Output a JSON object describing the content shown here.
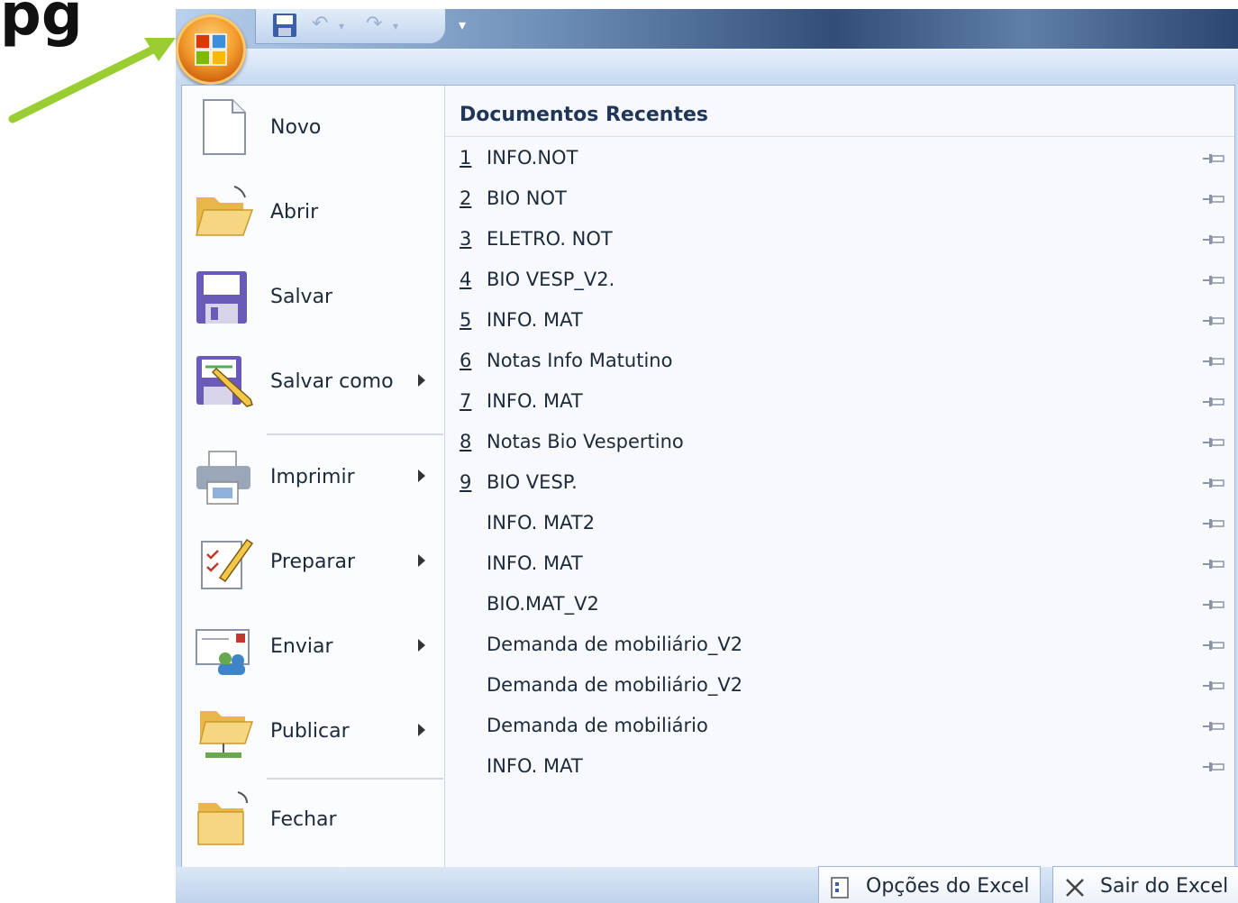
{
  "overlay": {
    "heading_fragment": "pg"
  },
  "quick_access": {
    "save_icon": "save-icon",
    "undo_icon": "undo-icon",
    "redo_icon": "redo-icon",
    "customize_icon": "customize-icon"
  },
  "office_button": {
    "icon": "office-logo-icon"
  },
  "commands": [
    {
      "label": "Novo",
      "icon": "new-document-icon"
    },
    {
      "label": "Abrir",
      "icon": "open-folder-icon"
    },
    {
      "label": "Salvar",
      "icon": "save-icon"
    },
    {
      "label": "Salvar como",
      "icon": "save-as-icon"
    },
    {
      "label": "Imprimir",
      "icon": "printer-icon"
    },
    {
      "label": "Preparar",
      "icon": "prepare-icon"
    },
    {
      "label": "Enviar",
      "icon": "send-icon"
    },
    {
      "label": "Publicar",
      "icon": "publish-icon"
    },
    {
      "label": "Fechar",
      "icon": "close-folder-icon"
    }
  ],
  "recent": {
    "title": "Documentos Recentes",
    "documents": [
      {
        "num": "1",
        "name": "INFO.NOT"
      },
      {
        "num": "2",
        "name": "BIO NOT"
      },
      {
        "num": "3",
        "name": "ELETRO. NOT"
      },
      {
        "num": "4",
        "name": "BIO VESP_V2."
      },
      {
        "num": "5",
        "name": "INFO. MAT"
      },
      {
        "num": "6",
        "name": "Notas Info Matutino"
      },
      {
        "num": "7",
        "name": "INFO. MAT"
      },
      {
        "num": "8",
        "name": "Notas Bio Vespertino"
      },
      {
        "num": "9",
        "name": "BIO VESP."
      },
      {
        "num": "",
        "name": "INFO. MAT2"
      },
      {
        "num": "",
        "name": "INFO. MAT"
      },
      {
        "num": "",
        "name": "BIO.MAT_V2"
      },
      {
        "num": "",
        "name": "Demanda de mobiliário_V2"
      },
      {
        "num": "",
        "name": "Demanda de mobiliário_V2"
      },
      {
        "num": "",
        "name": "Demanda de mobiliário"
      },
      {
        "num": "",
        "name": "INFO. MAT"
      }
    ]
  },
  "footer": {
    "options_label": "Opções do Excel",
    "exit_label": "Sair do Excel"
  },
  "colors": {
    "arrow": "#9acd32",
    "office_orange": "#f29a2b"
  }
}
